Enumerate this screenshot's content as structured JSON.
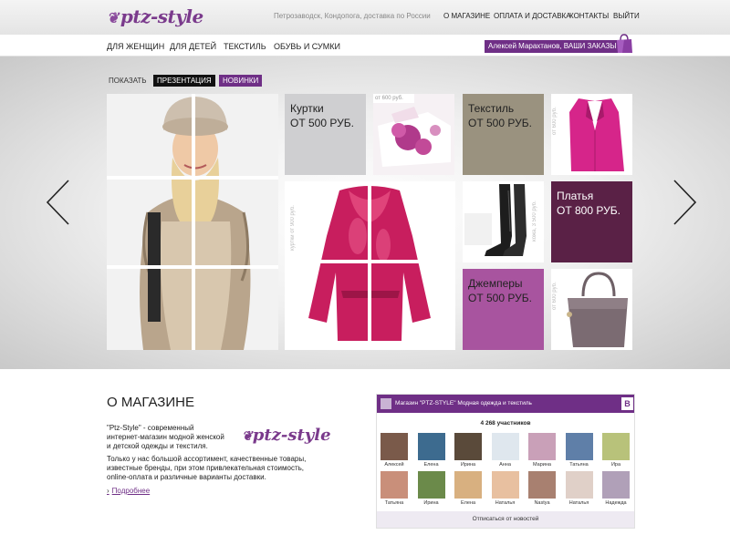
{
  "header": {
    "logo": "ptz-style",
    "location": "Петрозаводск, Кондопога, доставка по России",
    "nav": [
      "О МАГАЗИНЕ",
      "ОПЛАТА И ДОСТАВКА",
      "КОНТАКТЫ",
      "ВЫЙТИ"
    ]
  },
  "menu": {
    "items": [
      "ДЛЯ ЖЕНЩИН",
      "ДЛЯ ДЕТЕЙ",
      "ТЕКСТИЛЬ",
      "ОБУВЬ И СУМКИ"
    ],
    "user": "Алексей Марахтанов, ВАШИ ЗАКАЗЫ"
  },
  "hero": {
    "show_label": "ПОКАЗАТЬ",
    "buttons": [
      "ПРЕЗЕНТАЦИЯ",
      "НОВИНКИ"
    ],
    "tiles": {
      "jackets": {
        "title": "Куртки",
        "price": "ОТ 500 РУБ."
      },
      "textile": {
        "title": "Текстиль",
        "price": "ОТ 500 РУБ."
      },
      "dresses": {
        "title": "Платья",
        "price": "ОТ 800 РУБ."
      },
      "sweaters": {
        "title": "Джемперы",
        "price": "ОТ 500 РУБ."
      }
    },
    "price_tags": {
      "bedding": "от 600 руб.",
      "blazer": "от 600 руб.",
      "jacket": "куртки от 900 руб.",
      "boots": "кожа, 3 500 руб.",
      "bag": "от 600 руб."
    },
    "colors": {
      "gray": "#cfcfd1",
      "taupe": "#9a927f",
      "plum": "#5a2146",
      "purple": "#a8549f"
    }
  },
  "about": {
    "title": "О МАГАЗИНЕ",
    "lines1": [
      "\"Ptz-Style\" - современный",
      "интернет-магазин модной женской",
      "и детской одежды и текстиля."
    ],
    "lines2": [
      "Только у нас большой ассортимент, качественные товары,",
      "известные бренды, при этом привлекательная стоимость,",
      "online-оплата и различные варианты доставки."
    ],
    "more": "Подробнее",
    "logo": "ptz-style"
  },
  "vk": {
    "title": "Магазин \"PTZ-STYLE\" Модная одежда и текстиль",
    "badge": "В",
    "count": "4 268 участников",
    "members": [
      "Алексей",
      "Елена",
      "Ирина",
      "Анна",
      "Марина",
      "Татьяна",
      "Ира",
      "Татьяна",
      "Ирина",
      "Елена",
      "Наталья",
      "Nastya",
      "Наталья",
      "Надежда"
    ],
    "footer": "Отписаться от новостей"
  }
}
